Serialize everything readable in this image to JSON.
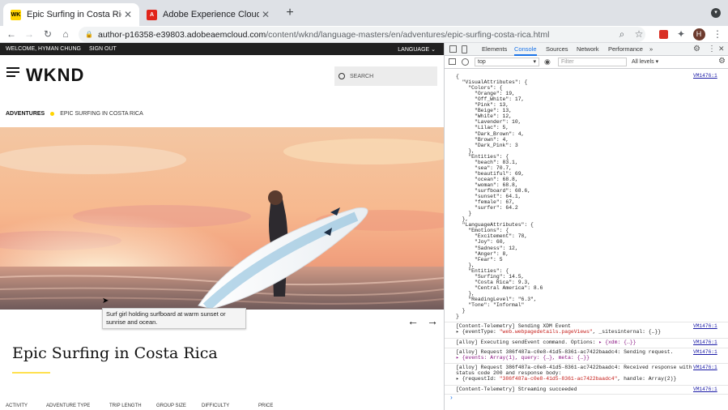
{
  "tabs": [
    {
      "title": "Epic Surfing in Costa Rica",
      "favicon": "WK",
      "active": true
    },
    {
      "title": "Adobe Experience Cloud",
      "favicon": "A",
      "active": false
    }
  ],
  "new_tab_label": "+",
  "omnibox": {
    "host": "author-p16358-e39803.adobeaemcloud.com",
    "path": "/content/wknd/language-masters/en/adventures/epic-surfing-costa-rica.html"
  },
  "profile_initial": "H",
  "site": {
    "welcome": "WELCOME, HYMAN CHUNG",
    "sign_out": "SIGN OUT",
    "language": "LANGUAGE",
    "logo": "WKND",
    "search_placeholder": "SEARCH",
    "breadcrumb": {
      "parent": "ADVENTURES",
      "current": "EPIC SURFING IN COSTA RICA"
    },
    "tooltip": "Surf girl holding surfboard at warm sunset or sunrise and ocean.",
    "title": "Epic Surfing in Costa Rica",
    "attributes": [
      "ACTIVITY",
      "ADVENTURE TYPE",
      "TRIP LENGTH",
      "GROUP SIZE",
      "DIFFICULTY",
      "PRICE"
    ]
  },
  "devtools": {
    "tabs": [
      "Elements",
      "Console",
      "Sources",
      "Network",
      "Performance",
      "»"
    ],
    "active_tab": "Console",
    "context": "top",
    "filter_placeholder": "Filter",
    "levels": "All levels ▾",
    "json_lines": [
      "{",
      "  \"VisualAttributes\": {",
      "    \"Colors\": {",
      "      \"Orange\": 19,",
      "      \"Off_White\": 17,",
      "      \"Pink\": 13,",
      "      \"Beige\": 13,",
      "      \"White\": 12,",
      "      \"Lavender\": 10,",
      "      \"Lilac\": 5,",
      "      \"Dark_Brown\": 4,",
      "      \"Brown\": 4,",
      "      \"Dark_Pink\": 3",
      "    },",
      "    \"Entities\": {",
      "      \"beach\": 83.1,",
      "      \"sea\": 70.7,",
      "      \"beautiful\": 69,",
      "      \"ocean\": 68.8,",
      "      \"woman\": 68.8,",
      "      \"surfboard\": 68.6,",
      "      \"sunset\": 64.1,",
      "      \"female\": 67,",
      "      \"surfer\": 64.2",
      "    }",
      "  },",
      "  \"LanguageAttributes\": {",
      "    \"Emotions\": {",
      "      \"Excitement\": 78,",
      "      \"Joy\": 60,",
      "      \"Sadness\": 12,",
      "      \"Anger\": 8,",
      "      \"Fear\": 5",
      "    },",
      "    \"Entities\": {",
      "      \"Surfing\": 14.5,",
      "      \"Costa Rica\": 9.3,",
      "      \"Central America\": 8.6",
      "    },",
      "    \"ReadingLevel\": \"6.3\",",
      "    \"Tone\": \"Informal\"",
      "  }",
      "}"
    ],
    "json_source": "VM1476:1",
    "messages": [
      {
        "text": "[Content-Telemetry] Sending XDM Event",
        "source": "VM1476:1",
        "detail_pre": "▸ {eventType: ",
        "detail_str": "\"web.webpagedetails.pageViews\"",
        "detail_post": ", _sitesinternal: {…}}"
      },
      {
        "text": "[alloy] Executing sendEvent command. Options: ",
        "text_obj": "▸ {xdm: {…}}",
        "source": "VM1476:1"
      },
      {
        "text": "[alloy] Request 386f487a-c0e8-41d5-8361-ac7422baadc4: Sending request.",
        "source": "VM1476:1",
        "detail_pre": "",
        "detail_obj": "▸ {events: Array(1), query: {…}, meta: {…}}"
      },
      {
        "text": "[alloy] Request 386f487a-c0e8-41d5-8361-ac7422baadc4: Received response with",
        "text2": "status code 200 and response body:",
        "source": "VM1476:1",
        "detail_pre": "▸ {requestId: ",
        "detail_str": "\"386f487a-c0e8-41d5-8361-ac7422baadc4\"",
        "detail_post": ", handle: Array(2)}"
      },
      {
        "text": "[Content-Telemetry] Streaming succeeded",
        "source": "VM1476:1"
      }
    ],
    "prompt": "›"
  }
}
